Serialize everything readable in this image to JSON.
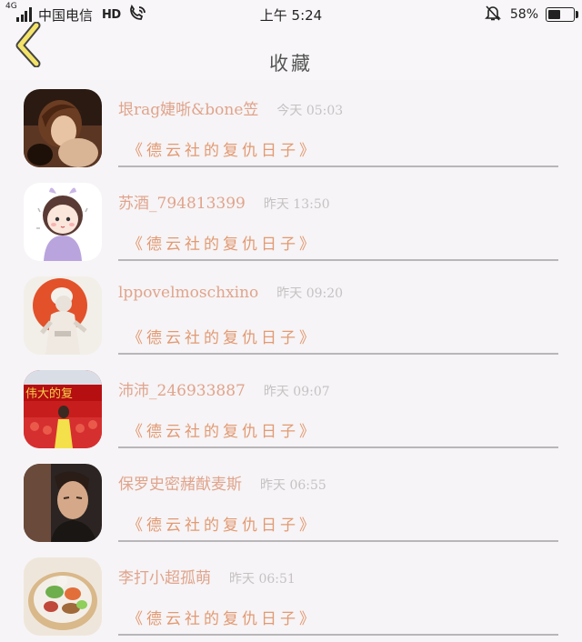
{
  "status_bar": {
    "network": "4G",
    "carrier": "中国电信",
    "hd": "HD",
    "time": "上午 5:24",
    "battery": "58%"
  },
  "header": {
    "title": "收藏"
  },
  "items": [
    {
      "username": "垠rag婕哳&bone笠",
      "time": "今天 05:03",
      "link": "《德云社的复仇日子》"
    },
    {
      "username": "苏酒_794813399",
      "time": "昨天 13:50",
      "link": "《德云社的复仇日子》"
    },
    {
      "username": "lppovelmoschxino",
      "time": "昨天 09:20",
      "link": "《德云社的复仇日子》"
    },
    {
      "username": "沛沛_246933887",
      "time": "昨天 09:07",
      "link": "《德云社的复仇日子》"
    },
    {
      "username": "保罗史密赭猷麦斯",
      "time": "昨天 06:55",
      "link": "《德云社的复仇日子》"
    },
    {
      "username": "李打小超孤萌",
      "time": "昨天 06:51",
      "link": "《德云社的复仇日子》"
    }
  ],
  "colors": {
    "username": "#e0a48c",
    "link": "#e29a73",
    "timestamp": "#c6c2c4",
    "back_chevron": "#f3e36a"
  },
  "icons": [
    "back-chevron-icon",
    "signal-icon",
    "hd-voice-icon",
    "wifi-call-icon",
    "mute-bell-icon",
    "battery-icon"
  ]
}
